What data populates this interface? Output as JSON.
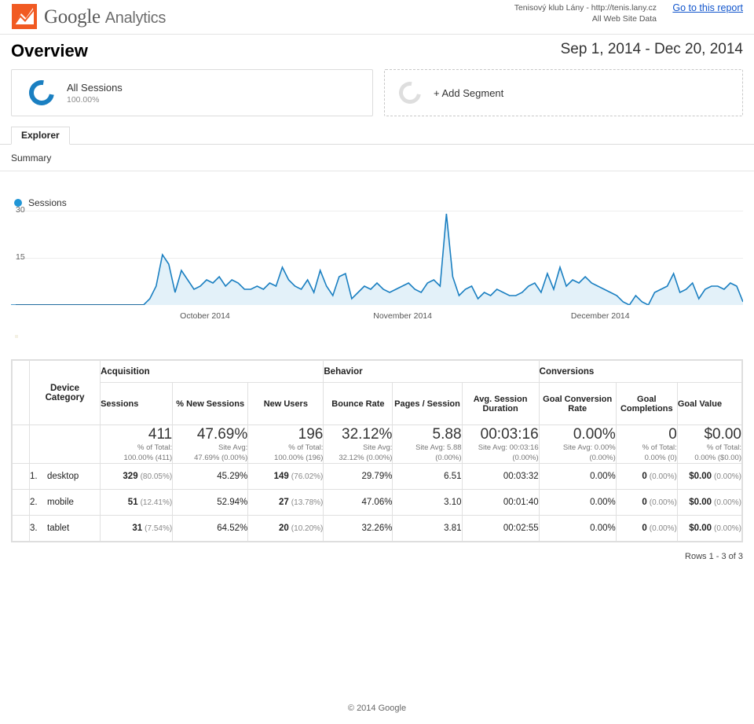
{
  "header": {
    "logo_text": "Google",
    "logo_subtext": "Analytics",
    "logo_icon": "analytics-logo-icon",
    "account_name": "Tenisový klub Lány - http://tenis.lany.cz",
    "view_name": "All Web Site Data",
    "report_link": "Go to this report"
  },
  "title": {
    "page_title": "Overview",
    "date_range": "Sep 1, 2014 - Dec 20, 2014"
  },
  "segments": [
    {
      "name": "All Sessions",
      "percent": "100.00%",
      "icon": "segment-donut-icon"
    },
    {
      "name": "+ Add Segment",
      "icon": "add-segment-donut-icon"
    }
  ],
  "tabs": {
    "explorer": "Explorer"
  },
  "summary_nav": {
    "label": "Summary"
  },
  "chart_data": {
    "type": "area",
    "title": "",
    "legend": [
      "Sessions"
    ],
    "legend_position": "top-left",
    "series_name": "Sessions",
    "line_color": "#1a7fc1",
    "fill_color": "#e3f1f9",
    "xlabel": "",
    "ylabel": "",
    "ylim": [
      0,
      30
    ],
    "yticks": [
      15,
      30
    ],
    "ytick_labels": [
      "15",
      "30"
    ],
    "grid": true,
    "xtick_labels": [
      "October 2014",
      "November 2014",
      "December 2014"
    ],
    "xtick_positions_pct": [
      26.5,
      53.5,
      80.5
    ],
    "x_start": "Sep 1, 2014",
    "x_end": "Dec 20, 2014",
    "values": [
      0,
      0,
      0,
      0,
      0,
      0,
      0,
      0,
      0,
      0,
      0,
      0,
      0,
      0,
      0,
      0,
      0,
      0,
      0,
      0,
      0,
      0,
      2,
      6,
      16,
      13,
      4,
      11,
      8,
      5,
      6,
      8,
      7,
      9,
      6,
      8,
      7,
      5,
      5,
      6,
      5,
      7,
      6,
      12,
      8,
      6,
      5,
      8,
      4,
      11,
      6,
      3,
      9,
      10,
      2,
      4,
      6,
      5,
      7,
      5,
      4,
      5,
      6,
      7,
      5,
      4,
      7,
      8,
      6,
      29,
      9,
      3,
      5,
      6,
      2,
      4,
      3,
      5,
      4,
      3,
      3,
      4,
      6,
      7,
      4,
      10,
      5,
      12,
      6,
      8,
      7,
      9,
      7,
      6,
      5,
      4,
      3,
      1,
      0,
      3,
      1,
      0,
      4,
      5,
      6,
      10,
      4,
      5,
      7,
      2,
      5,
      6,
      6,
      5,
      7,
      6,
      1
    ],
    "max_value": 29,
    "notes": "Daily sessions; flat at 0 for Sep 1-22, first activity around Sep 23, peak of ~29 in early November"
  },
  "table": {
    "groups": [
      {
        "label": "",
        "span": 2
      },
      {
        "label": "Acquisition",
        "span": 3
      },
      {
        "label": "Behavior",
        "span": 3
      },
      {
        "label": "Conversions",
        "span": 3
      }
    ],
    "dimension_header": "Device Category",
    "metric_headers": [
      "Sessions",
      "% New Sessions",
      "New Users",
      "Bounce Rate",
      "Pages / Session",
      "Avg. Session Duration",
      "Goal Conversion Rate",
      "Goal Completions",
      "Goal Value"
    ],
    "summary": [
      {
        "value": "411",
        "sub1": "% of Total:",
        "sub2": "100.00% (411)"
      },
      {
        "value": "47.69%",
        "sub1": "Site Avg:",
        "sub2": "47.69% (0.00%)"
      },
      {
        "value": "196",
        "sub1": "% of Total:",
        "sub2": "100.00% (196)"
      },
      {
        "value": "32.12%",
        "sub1": "Site Avg:",
        "sub2": "32.12% (0.00%)"
      },
      {
        "value": "5.88",
        "sub1": "Site Avg: 5.88",
        "sub2": "(0.00%)"
      },
      {
        "value": "00:03:16",
        "sub1": "Site Avg: 00:03:16",
        "sub2": "(0.00%)"
      },
      {
        "value": "0.00%",
        "sub1": "Site Avg: 0.00%",
        "sub2": "(0.00%)"
      },
      {
        "value": "0",
        "sub1": "% of Total:",
        "sub2": "0.00% (0)"
      },
      {
        "value": "$0.00",
        "sub1": "% of Total:",
        "sub2": "0.00% ($0.00)"
      }
    ],
    "rows": [
      {
        "index": "1.",
        "name": "desktop",
        "sessions": "329",
        "sessions_pct": "(80.05%)",
        "new_sessions_pct": "45.29%",
        "new_users": "149",
        "new_users_pct": "(76.02%)",
        "bounce_rate": "29.79%",
        "pages_session": "6.51",
        "avg_duration": "00:03:32",
        "goal_rate": "0.00%",
        "goal_completions": "0",
        "goal_completions_pct": "(0.00%)",
        "goal_value": "$0.00",
        "goal_value_pct": "(0.00%)"
      },
      {
        "index": "2.",
        "name": "mobile",
        "sessions": "51",
        "sessions_pct": "(12.41%)",
        "new_sessions_pct": "52.94%",
        "new_users": "27",
        "new_users_pct": "(13.78%)",
        "bounce_rate": "47.06%",
        "pages_session": "3.10",
        "avg_duration": "00:01:40",
        "goal_rate": "0.00%",
        "goal_completions": "0",
        "goal_completions_pct": "(0.00%)",
        "goal_value": "$0.00",
        "goal_value_pct": "(0.00%)"
      },
      {
        "index": "3.",
        "name": "tablet",
        "sessions": "31",
        "sessions_pct": "(7.54%)",
        "new_sessions_pct": "64.52%",
        "new_users": "20",
        "new_users_pct": "(10.20%)",
        "bounce_rate": "32.26%",
        "pages_session": "3.81",
        "avg_duration": "00:02:55",
        "goal_rate": "0.00%",
        "goal_completions": "0",
        "goal_completions_pct": "(0.00%)",
        "goal_value": "$0.00",
        "goal_value_pct": "(0.00%)"
      }
    ],
    "rows_info": "Rows 1 - 3 of 3"
  },
  "footer": {
    "copyright": "© 2014 Google"
  }
}
